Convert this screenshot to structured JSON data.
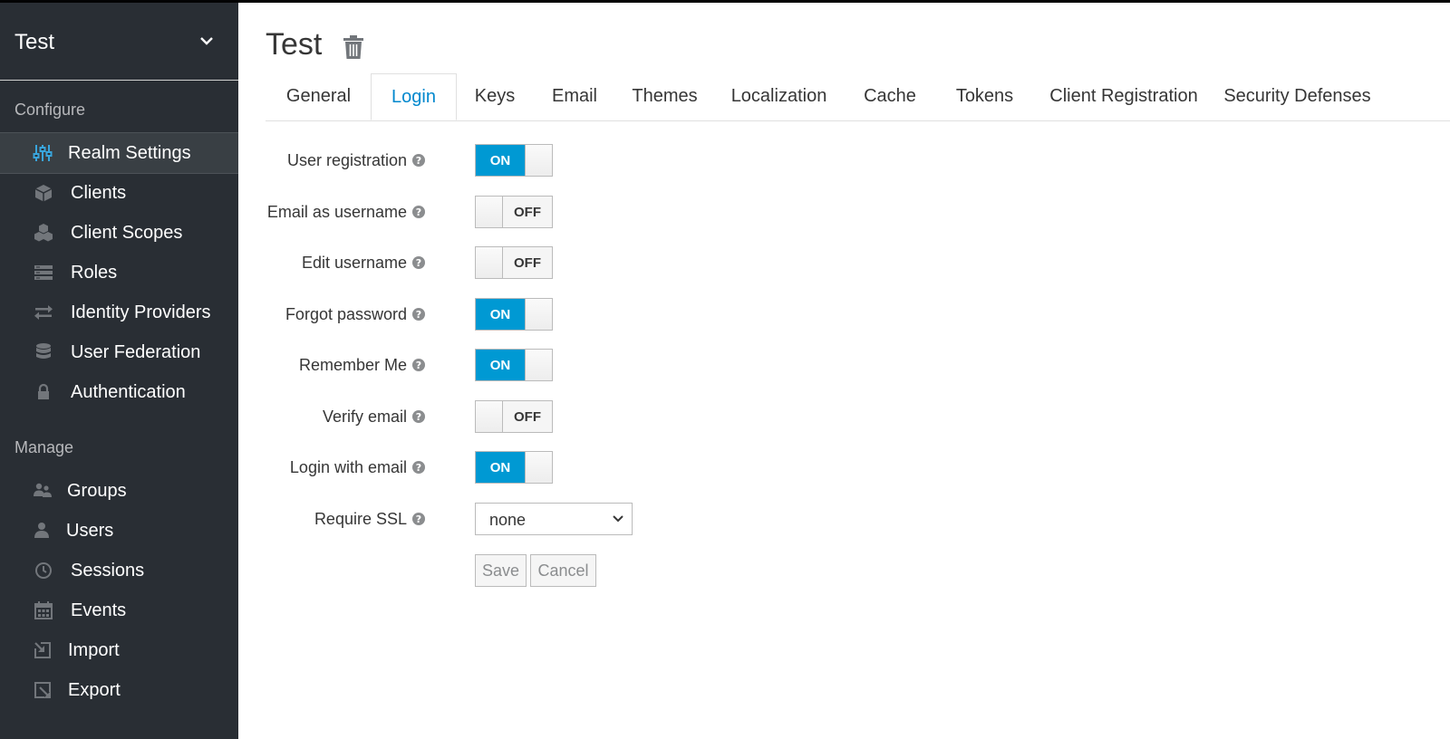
{
  "realm": {
    "name": "Test"
  },
  "sidebar": {
    "configure_label": "Configure",
    "manage_label": "Manage",
    "configure_items": [
      {
        "label": "Realm Settings",
        "icon": "sliders-icon",
        "active": true
      },
      {
        "label": "Clients",
        "icon": "cube-icon"
      },
      {
        "label": "Client Scopes",
        "icon": "cubes-icon"
      },
      {
        "label": "Roles",
        "icon": "list-icon"
      },
      {
        "label": "Identity Providers",
        "icon": "exchange-icon"
      },
      {
        "label": "User Federation",
        "icon": "database-icon"
      },
      {
        "label": "Authentication",
        "icon": "lock-icon"
      }
    ],
    "manage_items": [
      {
        "label": "Groups",
        "icon": "users-icon"
      },
      {
        "label": "Users",
        "icon": "user-icon"
      },
      {
        "label": "Sessions",
        "icon": "clock-icon"
      },
      {
        "label": "Events",
        "icon": "calendar-icon"
      },
      {
        "label": "Import",
        "icon": "import-icon"
      },
      {
        "label": "Export",
        "icon": "export-icon"
      }
    ]
  },
  "page": {
    "title": "Test"
  },
  "tabs": [
    {
      "label": "General"
    },
    {
      "label": "Login",
      "active": true
    },
    {
      "label": "Keys"
    },
    {
      "label": "Email"
    },
    {
      "label": "Themes"
    },
    {
      "label": "Localization"
    },
    {
      "label": "Cache"
    },
    {
      "label": "Tokens"
    },
    {
      "label": "Client Registration"
    },
    {
      "label": "Security Defenses"
    }
  ],
  "form": {
    "settings": [
      {
        "label": "User registration",
        "state": "ON"
      },
      {
        "label": "Email as username",
        "state": "OFF"
      },
      {
        "label": "Edit username",
        "state": "OFF"
      },
      {
        "label": "Forgot password",
        "state": "ON"
      },
      {
        "label": "Remember Me",
        "state": "ON"
      },
      {
        "label": "Verify email",
        "state": "OFF"
      },
      {
        "label": "Login with email",
        "state": "ON"
      }
    ],
    "require_ssl": {
      "label": "Require SSL",
      "value": "none"
    },
    "help_glyph": "?",
    "save_label": "Save",
    "cancel_label": "Cancel"
  },
  "colors": {
    "sidebar_bg": "#292e34",
    "accent": "#0088ce",
    "switch_on": "#0099d3"
  }
}
